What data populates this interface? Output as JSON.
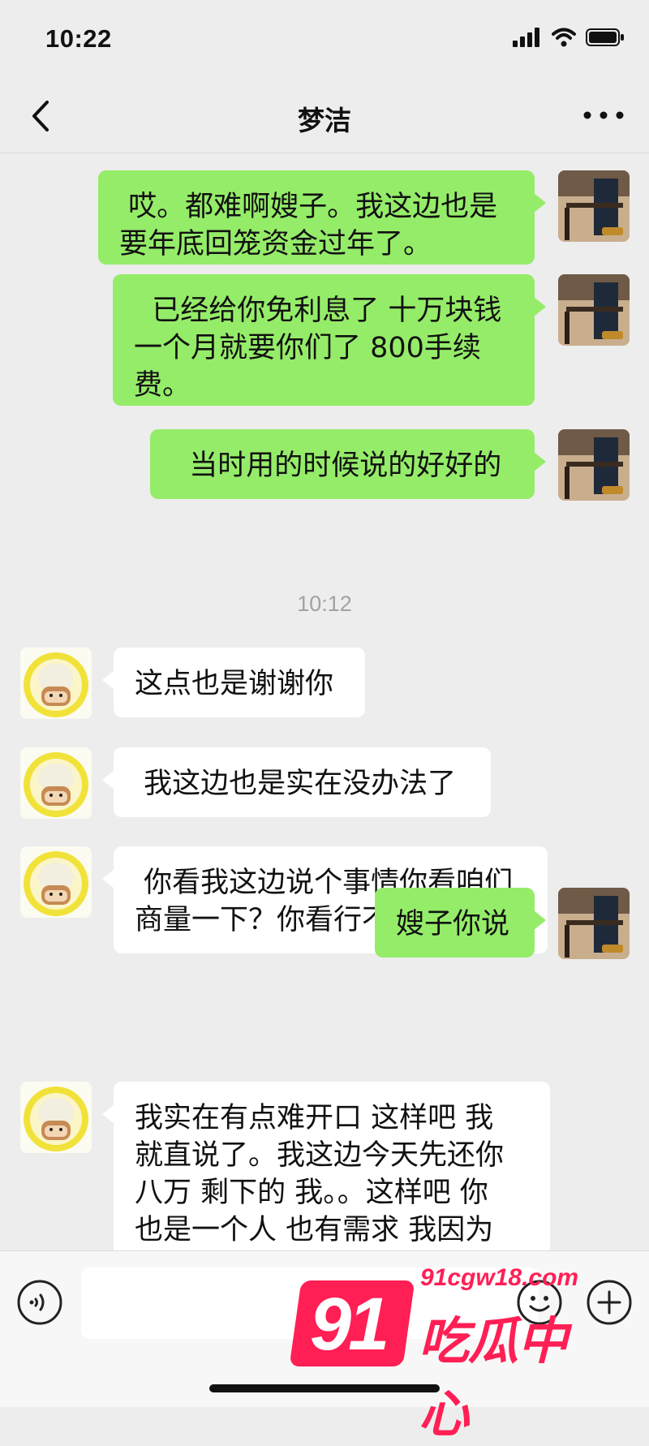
{
  "status_bar": {
    "time": "10:22"
  },
  "nav": {
    "title": "梦洁"
  },
  "messages": [
    {
      "side": "out",
      "text": " 哎。都难啊嫂子。我这边也是\n要年底回笼资金过年了。"
    },
    {
      "side": "out",
      "text": "  已经给你免利息了 十万块钱\n一个月就要你们了 800手续\n费。"
    },
    {
      "side": "out",
      "text": "  当时用的时候说的好好的"
    },
    {
      "side": "in",
      "text": "这点也是谢谢你"
    },
    {
      "side": "in",
      "text": " 我这边也是实在没办法了"
    },
    {
      "side": "in",
      "text": " 你看我这边说个事情你看咱们\n商量一下？你看行不"
    },
    {
      "side": "out",
      "text": "嫂子你说"
    },
    {
      "side": "in",
      "text": "我实在有点难开口 这样吧 我\n就直说了。我这边今天先还你\n八万 剩下的 我。。这样吧 你\n也是一个人 也有需求 我因为\n实用孩子的问题 可不能让你起"
    }
  ],
  "timestamp": "10:12",
  "watermark": {
    "number": "91",
    "domain": "91cgw18.com",
    "name": "吃瓜中心"
  },
  "colors": {
    "outgoing_bubble": "#95ec69",
    "incoming_bubble": "#ffffff",
    "background": "#ededed",
    "watermark": "#ff1f55"
  }
}
